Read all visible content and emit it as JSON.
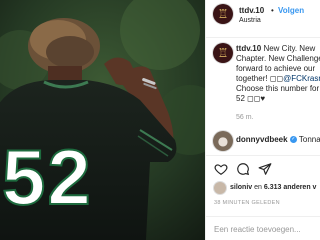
{
  "post": {
    "username": "ttdv.10",
    "location": "Austria",
    "follow_label": "Volgen",
    "separator": "•",
    "photo": {
      "jersey_number": "52"
    }
  },
  "caption": {
    "username": "ttdv.10",
    "line1": "New City. New",
    "line2": "Chapter. New Challenge",
    "line3": "forward to achieve our",
    "line4_prefix": "together! ",
    "line4_tag": "@FCKrasno",
    "line5": "Choose this number for",
    "line6": "52 ",
    "age": "56 m."
  },
  "comments": [
    {
      "username": "donnyvdbeek",
      "text": "Tonna",
      "verified": true
    }
  ],
  "likes": {
    "user": "siloniv",
    "connector": "en",
    "count": "6.313",
    "suffix": "anderen v"
  },
  "timestamp": "38 MINUTEN GELEDEN",
  "comment_field": {
    "placeholder": "Een reactie toevoegen..."
  },
  "colors": {
    "accent": "#3897f0",
    "text": "#262626",
    "muted": "#999999",
    "avatar_bg": "#3a1416",
    "avatar_gold": "#e9c46a"
  }
}
